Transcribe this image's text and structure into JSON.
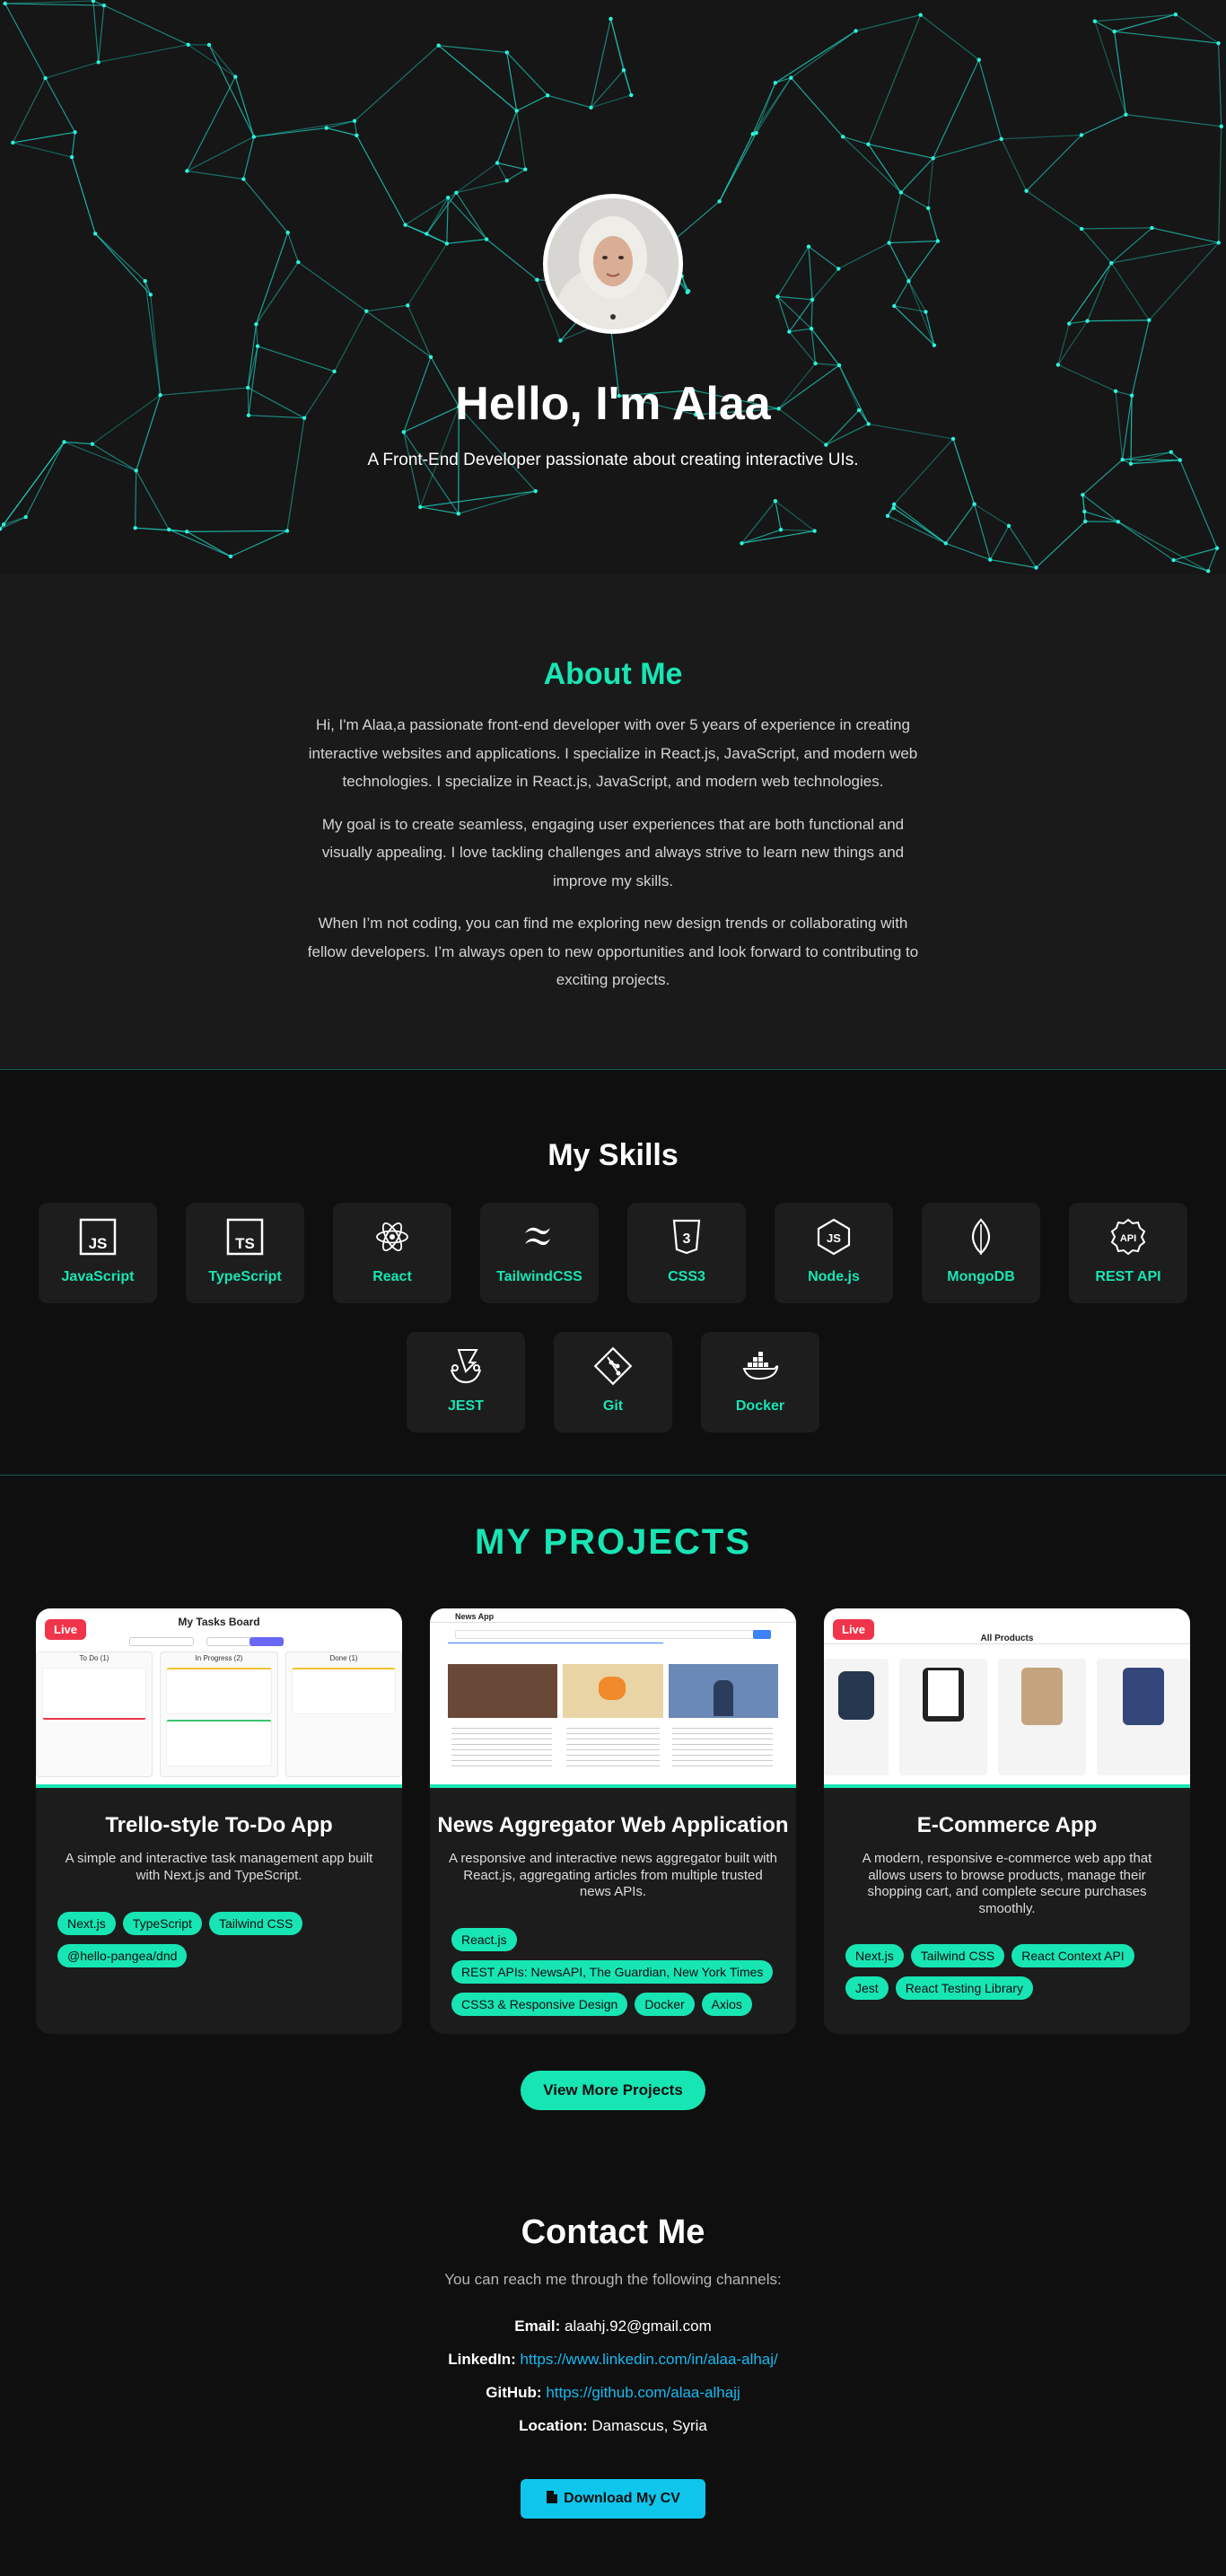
{
  "hero": {
    "title": "Hello, I'm Alaa",
    "subtitle": "A Front-End Developer passionate about creating interactive UIs."
  },
  "about": {
    "heading": "About Me",
    "paragraphs": [
      "Hi, I'm Alaa,a passionate front-end developer with over 5 years of experience in creating interactive websites and applications. I specialize in React.js, JavaScript, and modern web technologies. I specialize in React.js, JavaScript, and modern web technologies.",
      "My goal is to create seamless, engaging user experiences that are both functional and visually appealing. I love tackling challenges and always strive to learn new things and improve my skills.",
      "When I’m not coding, you can find me exploring new design trends or collaborating with fellow developers. I’m always open to new opportunities and look forward to contributing to exciting projects."
    ]
  },
  "skills": {
    "heading": "My Skills",
    "items": [
      {
        "label": "JavaScript",
        "icon": "javascript-icon"
      },
      {
        "label": "TypeScript",
        "icon": "typescript-icon"
      },
      {
        "label": "React",
        "icon": "react-icon"
      },
      {
        "label": "TailwindCSS",
        "icon": "tailwind-icon"
      },
      {
        "label": "CSS3",
        "icon": "css3-icon"
      },
      {
        "label": "Node.js",
        "icon": "nodejs-icon"
      },
      {
        "label": "MongoDB",
        "icon": "mongodb-icon"
      },
      {
        "label": "REST API",
        "icon": "api-icon"
      },
      {
        "label": "JEST",
        "icon": "jest-icon"
      },
      {
        "label": "Git",
        "icon": "git-icon"
      },
      {
        "label": "Docker",
        "icon": "docker-icon"
      }
    ]
  },
  "projects": {
    "heading": "MY PROJECTS",
    "live_label": "Live",
    "more_label": "View More Projects",
    "cards": [
      {
        "title": "Trello-style To-Do App",
        "description": "A simple and interactive task management app built with Next.js and TypeScript.",
        "live": true,
        "tags": [
          "Next.js",
          "TypeScript",
          "Tailwind CSS",
          "@hello-pangea/dnd"
        ],
        "screenshot_title": "My Tasks Board",
        "screenshot_columns": [
          "To Do (1)",
          "In Progress (2)",
          "Done (1)"
        ]
      },
      {
        "title": "News Aggregator Web Application",
        "description": "A responsive and interactive news aggregator built with React.js, aggregating articles from multiple trusted news APIs.",
        "live": false,
        "tags": [
          "React.js",
          "REST APIs: NewsAPI, The Guardian, New York Times",
          "CSS3 & Responsive Design",
          "Docker",
          "Axios"
        ],
        "screenshot_title": "News App"
      },
      {
        "title": "E-Commerce App",
        "description": "A modern, responsive e-commerce web app that allows users to browse products, manage their shopping cart, and complete secure purchases smoothly.",
        "live": true,
        "tags": [
          "Next.js",
          "Tailwind CSS",
          "React Context API",
          "Jest",
          "React Testing Library"
        ],
        "screenshot_title": "All Products"
      }
    ]
  },
  "contact": {
    "heading": "Contact Me",
    "subtitle": "You can reach me through the following channels:",
    "email_label": "Email:",
    "email": "alaahj.92@gmail.com",
    "linkedin_label": "LinkedIn:",
    "linkedin": "https://www.linkedin.com/in/alaa-alhaj/",
    "github_label": "GitHub:",
    "github": "https://github.com/alaa-alhajj",
    "location_label": "Location:",
    "location": "Damascus, Syria",
    "cv_label": "Download My CV"
  },
  "colors": {
    "accent": "#18e5b4",
    "live_badge": "#f0344a",
    "link": "#19b9f0",
    "cv_button": "#0ec6ec"
  }
}
